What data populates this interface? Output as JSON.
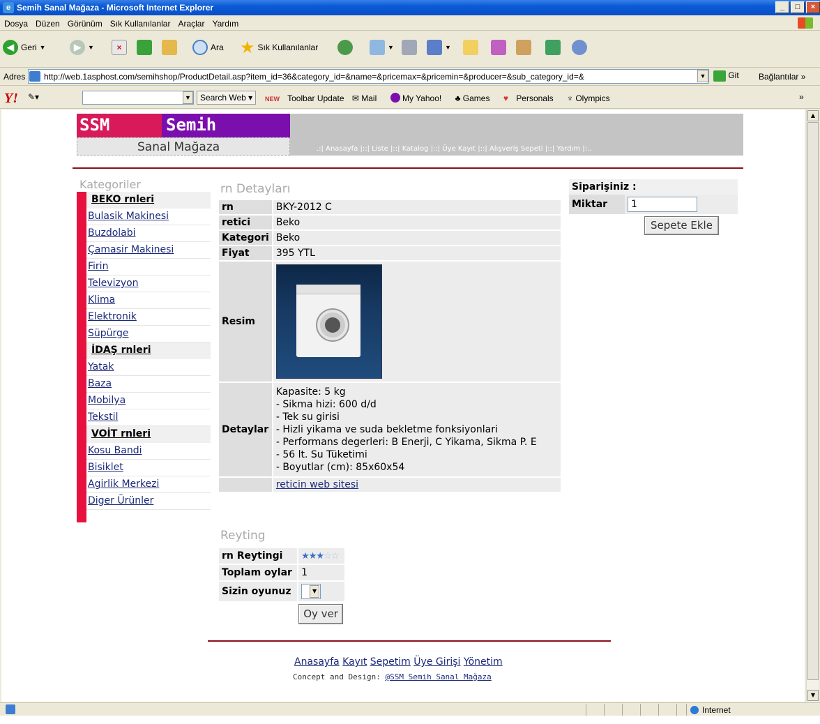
{
  "window": {
    "title": "Semih Sanal Mağaza - Microsoft Internet Explorer"
  },
  "menu": [
    "Dosya",
    "Düzen",
    "Görünüm",
    "Sık Kullanılanlar",
    "Araçlar",
    "Yardım"
  ],
  "toolbar": {
    "back": "Geri",
    "search": "Ara",
    "favorites": "Sık Kullanılanlar"
  },
  "address": {
    "label": "Adres",
    "url": "http://web.1asphost.com/semihshop/ProductDetail.asp?item_id=36&category_id=&name=&pricemax=&pricemin=&producer=&sub_category_id=&",
    "go": "Git",
    "links": "Bağlantılar"
  },
  "yahoo": {
    "logo": "Y!",
    "search_web": "Search Web",
    "items": [
      "Toolbar Update",
      "Mail",
      "My Yahoo!",
      "Games",
      "Personals",
      "Olympics"
    ],
    "new_badge": "NEW",
    "more": "»"
  },
  "site": {
    "logo_left": "SSM",
    "logo_right": "Semih",
    "logo_sub": "Sanal Mağaza",
    "nav": [
      ".:|",
      "Anasayfa",
      "|::|",
      "Liste",
      "|::|",
      "Katalog",
      "|::|",
      "Üye Kayıt",
      "|::|",
      "Alışveriş Sepeti",
      "|::|",
      "Yardım",
      "|:.."
    ]
  },
  "categories": {
    "title": "Kategoriler",
    "items": [
      {
        "label": "BEKO rnleri",
        "group": true
      },
      {
        "label": "Bulasik Makinesi"
      },
      {
        "label": "Buzdolabi"
      },
      {
        "label": "Çamasir Makinesi"
      },
      {
        "label": "Firin"
      },
      {
        "label": "Televizyon"
      },
      {
        "label": "Klima"
      },
      {
        "label": "Elektronik"
      },
      {
        "label": "Süpürge"
      },
      {
        "label": "İDAŞ rnleri",
        "group": true
      },
      {
        "label": "Yatak"
      },
      {
        "label": "Baza"
      },
      {
        "label": "Mobilya"
      },
      {
        "label": "Tekstil"
      },
      {
        "label": "VOİT rnleri",
        "group": true
      },
      {
        "label": "Kosu Bandi"
      },
      {
        "label": "Bisiklet"
      },
      {
        "label": "Agirlik Merkezi"
      },
      {
        "label": "Diger Ürünler"
      }
    ]
  },
  "details": {
    "title": "rn Detayları",
    "product_label": "rn",
    "product": "BKY-2012 C",
    "producer_label": "retici",
    "producer": "Beko",
    "category_label": "Kategori",
    "category": "Beko",
    "price_label": "Fiyat",
    "price": "395 YTL",
    "image_label": "Resim",
    "desc_label": "Detaylar",
    "desc_lines": [
      "Kapasite: 5 kg",
      "- Sikma hizi: 600 d/d",
      "- Tek su girisi",
      "- Hizli yikama ve suda bekletme fonksiyonlari",
      "- Performans degerleri: B Enerji, C Yikama, Sikma P. E",
      "- 56 lt. Su Tüketimi",
      "- Boyutlar (cm): 85x60x54"
    ],
    "web_link": "reticin web sitesi"
  },
  "order": {
    "title": "Siparişiniz :",
    "qty_label": "Miktar",
    "qty_value": "1",
    "add_button": "Sepete Ekle"
  },
  "rating": {
    "title": "Reyting",
    "rating_label": "rn Reytingi",
    "stars_on": 3,
    "stars_total": 5,
    "total_label": "Toplam oylar",
    "total": "1",
    "your_label": "Sizin oyunuz",
    "vote_button": "Oy ver"
  },
  "footer": {
    "links": [
      "Anasayfa",
      "Kayıt",
      "Sepetim",
      "Üye Girişi",
      "Yönetim"
    ],
    "credit_prefix": "Concept and Design:",
    "credit_link": "@SSM Semih Sanal Mağaza"
  },
  "status": {
    "zone": "Internet"
  }
}
